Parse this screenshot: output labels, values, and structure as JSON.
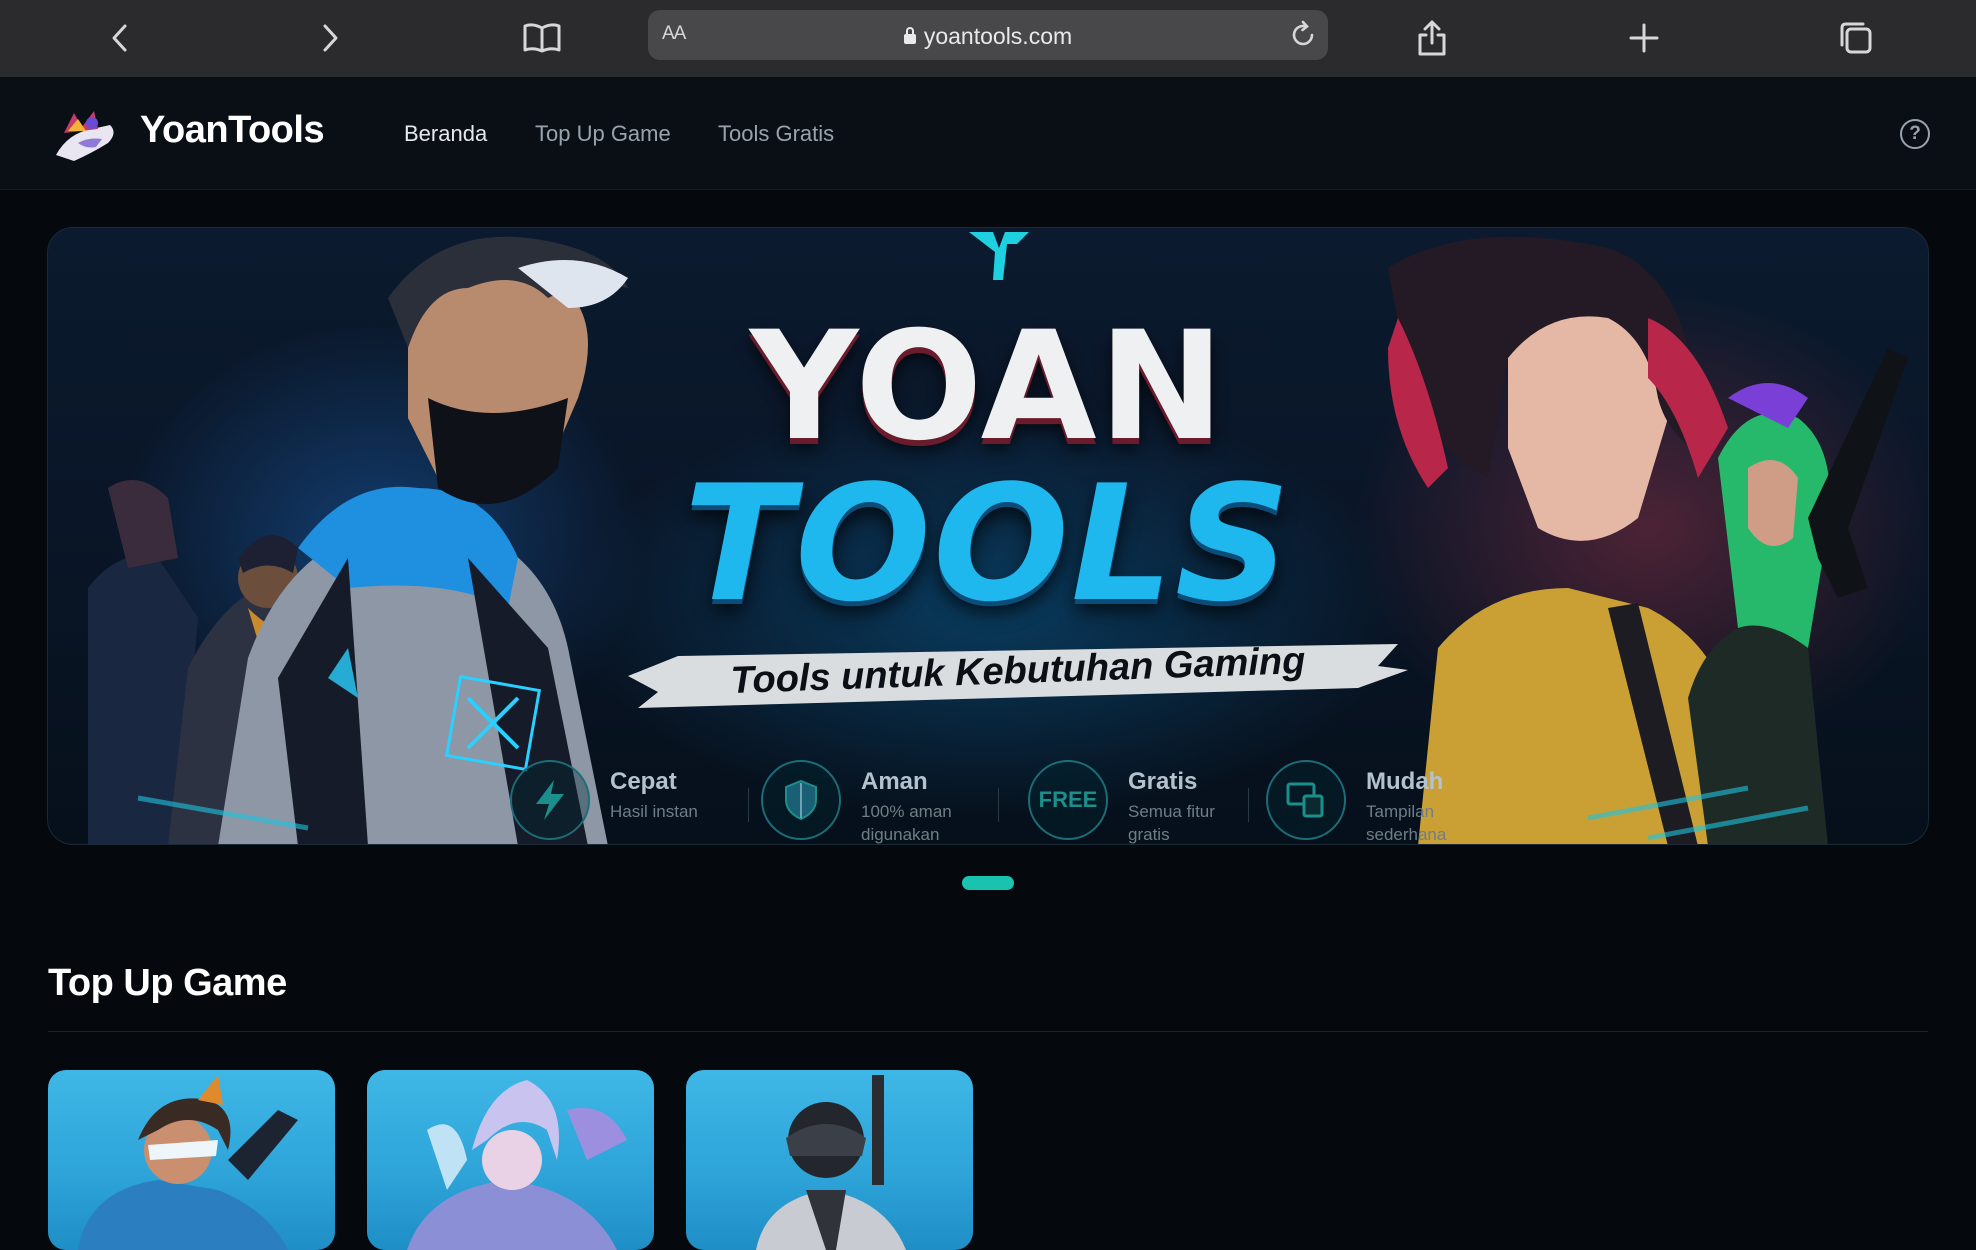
{
  "browser": {
    "text_size_label": "AA",
    "url": "yoantools.com"
  },
  "header": {
    "brand": "YoanTools",
    "nav": [
      {
        "label": "Beranda",
        "active": true
      },
      {
        "label": "Top Up Game",
        "active": false
      },
      {
        "label": "Tools Gratis",
        "active": false
      }
    ],
    "help_label": "?"
  },
  "hero": {
    "title_line1": "YOAN",
    "title_line2": "TOOLS",
    "tagline": "Tools untuk Kebutuhan Gaming",
    "features": [
      {
        "icon": "lightning-icon",
        "title": "Cepat",
        "subtitle": "Hasil instan"
      },
      {
        "icon": "shield-icon",
        "title": "Aman",
        "subtitle": "100% aman digunakan"
      },
      {
        "icon": "free-badge-icon",
        "badge": "FREE",
        "title": "Gratis",
        "subtitle": "Semua fitur gratis"
      },
      {
        "icon": "devices-icon",
        "title": "Mudah",
        "subtitle": "Tampilan sederhana"
      }
    ]
  },
  "carousel": {
    "active_index": 0,
    "count": 1
  },
  "top_up_section": {
    "title": "Top Up Game",
    "cards": [
      {
        "name": "game-card-1"
      },
      {
        "name": "game-card-2"
      },
      {
        "name": "game-card-3"
      }
    ]
  },
  "colors": {
    "accent": "#19c3b0",
    "page_bg": "#05080d",
    "header_bg": "#0a0f16",
    "hero_cyan": "#1fb8ee",
    "card_blue": "#2da3d8"
  }
}
